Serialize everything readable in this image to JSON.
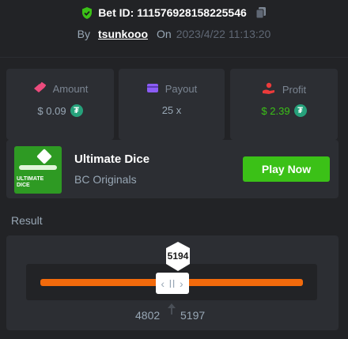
{
  "header": {
    "bet_id_label": "Bet ID: 111576928158225546",
    "by_label": "By",
    "username": "tsunkooo",
    "on_label": "On",
    "timestamp": "2023/4/22 11:13:20"
  },
  "stats": {
    "amount": {
      "label": "Amount",
      "value": "$ 0.09",
      "icon": "amount-coins-icon"
    },
    "payout": {
      "label": "Payout",
      "value": "25 x",
      "icon": "wallet-icon"
    },
    "profit": {
      "label": "Profit",
      "value": "$ 2.39",
      "icon": "profit-hand-icon"
    }
  },
  "game": {
    "title": "Ultimate Dice",
    "subtitle": "BC Originals",
    "play_label": "Play Now",
    "thumb_text": "ULTIMATE\nDICE"
  },
  "result": {
    "label": "Result",
    "roll": "5194",
    "range_low": "4802",
    "range_high": "5197",
    "handle_glyph": "‹ ll ›"
  },
  "colors": {
    "background": "#222326",
    "panel": "#2c2e33",
    "green": "#3bc117",
    "orange_bar": "#f26a0c",
    "tether": "#26a17b"
  }
}
